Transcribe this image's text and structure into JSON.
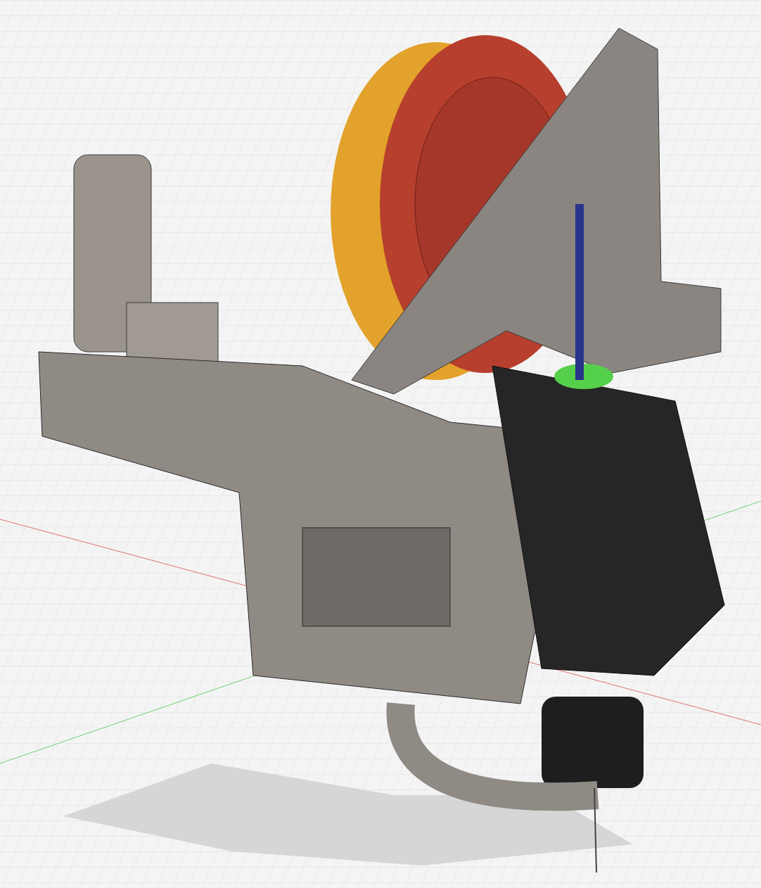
{
  "viewport": {
    "grid_visible": true,
    "axes": [
      {
        "kind": "x",
        "color": "#e07070"
      },
      {
        "kind": "y",
        "color": "#70d070"
      }
    ]
  }
}
